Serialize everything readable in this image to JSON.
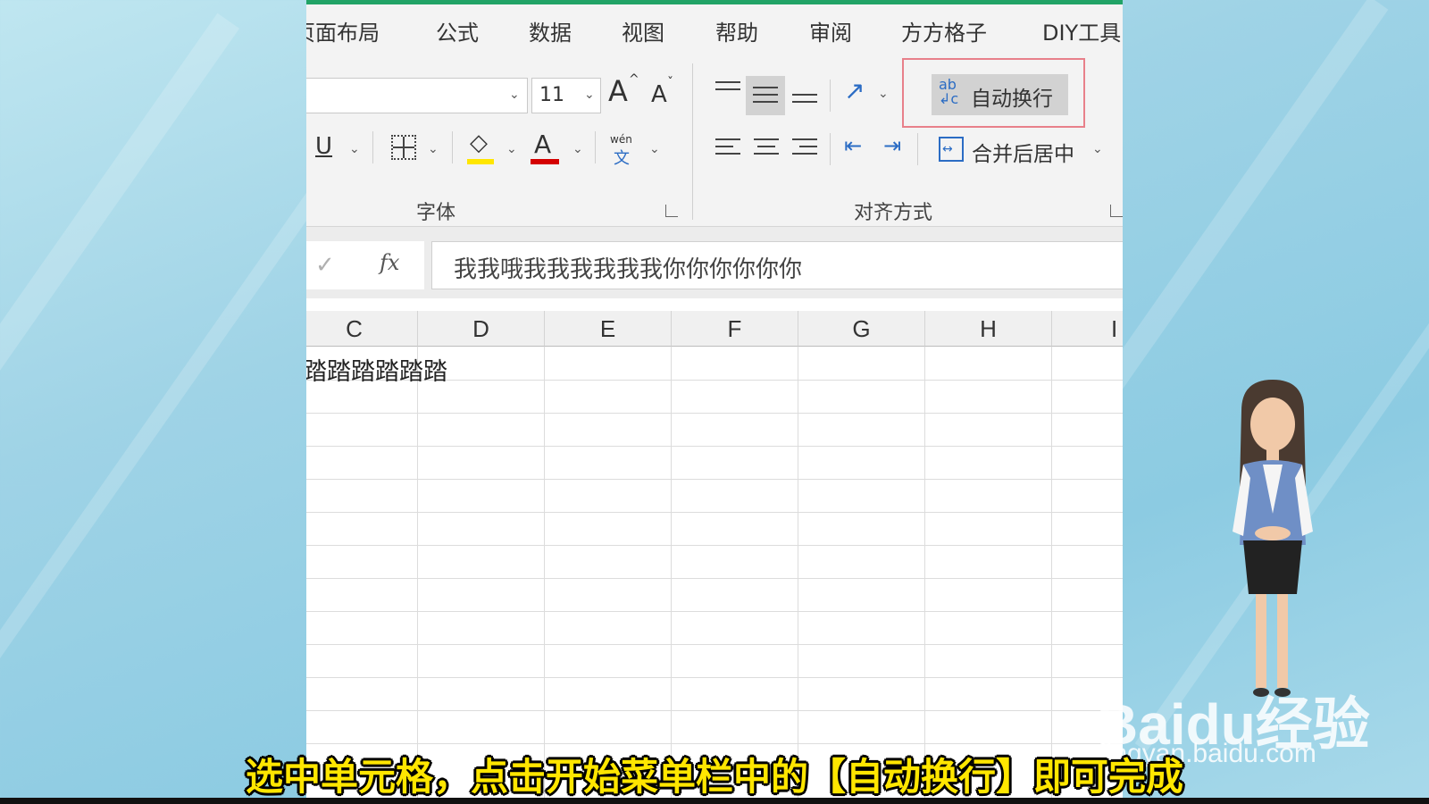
{
  "menu": {
    "items": [
      "页面布局",
      "公式",
      "数据",
      "视图",
      "帮助",
      "审阅",
      "方方格子",
      "DIY工具"
    ]
  },
  "ribbon": {
    "font_size_value": "11",
    "grow_font_label": "A",
    "shrink_font_label": "A",
    "underline_label": "U",
    "font_color_label": "A",
    "phonetic_top": "wén",
    "phonetic_bottom": "文",
    "wrap_text_label": "自动换行",
    "merge_center_label": "合并后居中",
    "font_group_label": "字体",
    "alignment_group_label": "对齐方式"
  },
  "formula_bar": {
    "confirm_icon": "✓",
    "fx_label": "fx",
    "content": "我我哦我我我我我我你你你你你你"
  },
  "sheet": {
    "columns": [
      "C",
      "D",
      "E",
      "F",
      "G",
      "H",
      "I"
    ],
    "cell_text": "踏踏踏踏踏踏"
  },
  "caption": "选中单元格，点击开始菜单栏中的【自动换行】即可完成",
  "watermark": {
    "brand": "Baidu经验",
    "url": "jingyan.baidu.com"
  },
  "colors": {
    "excel_green": "#21a366",
    "highlight_box": "#e8808a",
    "caption_yellow": "#ffe600",
    "font_color_bar": "#d40000",
    "fill_color_bar": "#ffe600"
  }
}
